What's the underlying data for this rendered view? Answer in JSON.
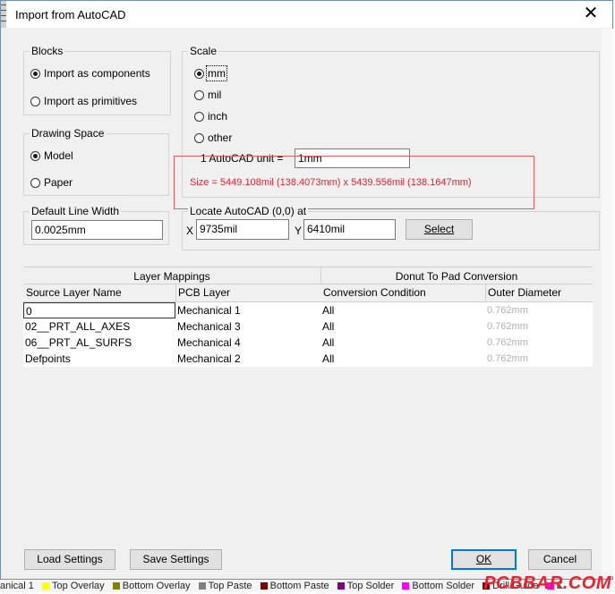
{
  "window": {
    "title": "Import from AutoCAD",
    "close_glyph": "✕"
  },
  "blocks": {
    "label": "Blocks",
    "options": [
      "Import as components",
      "Import as primitives"
    ],
    "selected": 0
  },
  "scale": {
    "label": "Scale",
    "options": [
      "mm",
      "mil",
      "inch",
      "other"
    ],
    "selected": 0,
    "unit_label": "1 AutoCAD unit =",
    "unit_value": "1mm",
    "size_text": "Size = 5449.108mil (138.4073mm) x 5439.556mil (138.1647mm)"
  },
  "drawing_space": {
    "label": "Drawing Space",
    "options": [
      "Model",
      "Paper"
    ],
    "selected": 0
  },
  "line_width": {
    "label": "Default Line Width",
    "value": "0.0025mm"
  },
  "locate": {
    "label": "Locate AutoCAD (0,0) at",
    "x_label": "X",
    "x_value": "9735mil",
    "y_label": "Y",
    "y_value": "6410mil",
    "select_label": "Select"
  },
  "table": {
    "group1": "Layer Mappings",
    "group2": "Donut To Pad Conversion",
    "columns": [
      "Source Layer Name",
      "PCB Layer",
      "Conversion Condition",
      "Outer Diameter"
    ],
    "rows": [
      [
        "0",
        "Mechanical 1",
        "All",
        "0.762mm"
      ],
      [
        "02__PRT_ALL_AXES",
        "Mechanical 3",
        "All",
        "0.762mm"
      ],
      [
        "06__PRT_AL_SURFS",
        "Mechanical 4",
        "All",
        "0.762mm"
      ],
      [
        "Defpoints",
        "Mechanical 2",
        "All",
        "0.762mm"
      ]
    ]
  },
  "buttons": {
    "load": "Load Settings",
    "save": "Save Settings",
    "ok": "OK",
    "cancel": "Cancel"
  },
  "layer_tabs": [
    {
      "label": "anical 1",
      "color": "#f5f5f5"
    },
    {
      "label": "Top Overlay",
      "color": "#ffff00"
    },
    {
      "label": "Bottom Overlay",
      "color": "#808000"
    },
    {
      "label": "Top Paste",
      "color": "#808080"
    },
    {
      "label": "Bottom Paste",
      "color": "#800000"
    },
    {
      "label": "Top Solder",
      "color": "#800080"
    },
    {
      "label": "Bottom Solder",
      "color": "#ff00ff"
    },
    {
      "label": "Drill Guide",
      "color": "#800000"
    },
    {
      "label": "K",
      "color": "#ff00ff"
    }
  ],
  "watermark": "PCBBAR.COM"
}
